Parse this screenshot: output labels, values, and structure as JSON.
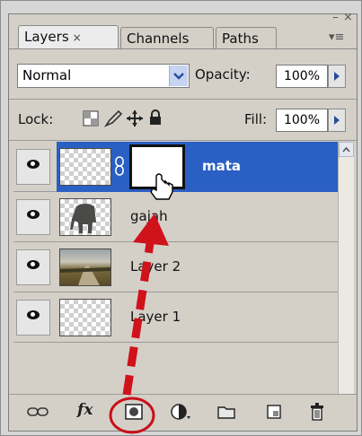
{
  "window": {
    "minimize_glyph": "–",
    "close_glyph": "×",
    "menu_glyph": "▾≡"
  },
  "tabs": [
    {
      "label": "Layers",
      "close": "×",
      "active": true
    },
    {
      "label": "Channels",
      "active": false
    },
    {
      "label": "Paths",
      "active": false
    }
  ],
  "blend": {
    "value": "Normal",
    "arrow": "v"
  },
  "opacity": {
    "label": "Opacity:",
    "value": "100%",
    "arrow": "▶"
  },
  "lock": {
    "label": "Lock:"
  },
  "fill": {
    "label": "Fill:",
    "value": "100%",
    "arrow": "▶"
  },
  "layers": [
    {
      "name": "mata",
      "selected": true,
      "has_mask": true,
      "thumb": "transparent"
    },
    {
      "name": "gajah",
      "selected": false,
      "thumb": "elephant"
    },
    {
      "name": "Layer 2",
      "selected": false,
      "thumb": "landscape"
    },
    {
      "name": "Layer 1",
      "selected": false,
      "thumb": "transparent"
    }
  ],
  "bottom_bar": {
    "fx_label": "fx",
    "icons": [
      "link-icon",
      "fx-icon",
      "add-mask-icon",
      "adjustment-layer-icon",
      "new-group-icon",
      "new-layer-icon",
      "trash-icon"
    ]
  },
  "colors": {
    "selection": "#2a5fc4",
    "annotation": "#d0121b"
  }
}
